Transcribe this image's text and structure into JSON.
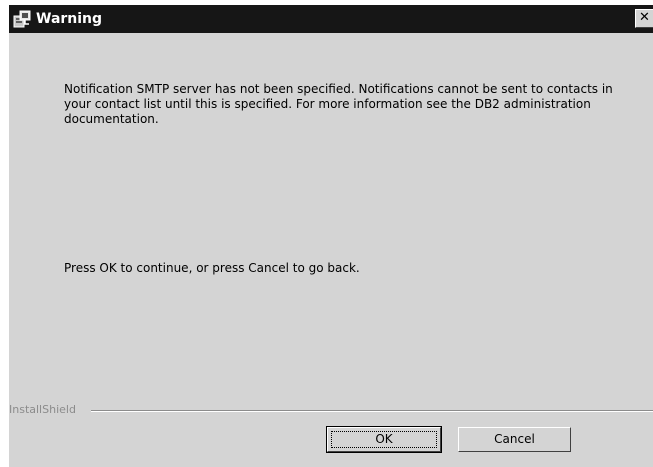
{
  "window": {
    "title": "Warning",
    "close_symbol": "✕",
    "icon": "installer-icon"
  },
  "content": {
    "message": "Notification SMTP server has not been specified. Notifications cannot be sent to contacts in your contact list until this is specified. For more information see the DB2 administration documentation.",
    "prompt": "Press OK to continue, or press Cancel to go back."
  },
  "footer": {
    "brand": "InstallShield",
    "ok_label": "OK",
    "cancel_label": "Cancel"
  },
  "colors": {
    "titlebar": "#161616",
    "window_bg": "#d4d4d4",
    "brand_text": "#8c8c8c"
  }
}
